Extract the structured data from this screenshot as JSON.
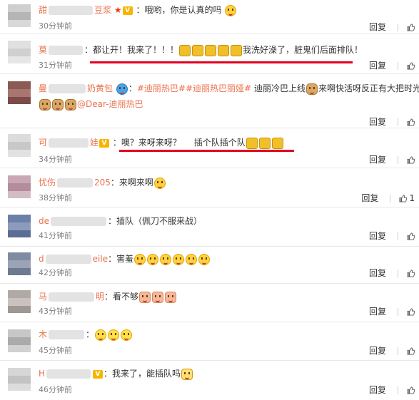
{
  "colors": {
    "username": "#eb7350",
    "annotation": "#e4001e",
    "text": "#333333",
    "time": "#808080"
  },
  "actions": {
    "reply": "回复"
  },
  "comments": [
    {
      "name_prefix": "甜",
      "name_suffix": "豆浆",
      "text": "：哦哟，你是认真的吗",
      "time": "30分钟前",
      "likes": ""
    },
    {
      "name_prefix": "莫",
      "name_suffix": "",
      "text_before": "：都让开！我来了！！！",
      "text_after": "我洗好澡了，脏鬼们后面排队！",
      "time": "31分钟前",
      "likes": ""
    },
    {
      "name_prefix": "曼",
      "name_suffix": "奶黄包",
      "topic1": "#迪丽热巴#",
      "topic2": "#迪丽热巴丽娅#",
      "text": " 迪丽冷巴上线",
      "text_after": "来啊快活呀反正有大把时光",
      "mention": "@Dear-迪丽热巴",
      "time": "",
      "likes": ""
    },
    {
      "name_prefix": "可",
      "name_suffix": "娃",
      "text": "：噢？来呀来呀？",
      "text_after": "插个队插个队",
      "time": "34分钟前",
      "likes": ""
    },
    {
      "name_prefix": "忧伤",
      "name_suffix": "205",
      "text": "：来啊来啊",
      "time": "38分钟前",
      "likes": "1"
    },
    {
      "name_prefix": "de",
      "name_suffix": "",
      "text": "：插队（佩刀不服来战）",
      "time": "41分钟前",
      "likes": ""
    },
    {
      "name_prefix": "d",
      "name_suffix": "eile",
      "text": "：害羞",
      "time": "42分钟前",
      "likes": ""
    },
    {
      "name_prefix": "马",
      "name_suffix": "明",
      "text": "：看不够",
      "time": "43分钟前",
      "likes": ""
    },
    {
      "name_prefix": "木",
      "name_suffix": "",
      "text": "：",
      "time": "45分钟前",
      "likes": ""
    },
    {
      "name_prefix": "H",
      "name_suffix": "",
      "text": "：我来了，能插队吗",
      "time": "46分钟前",
      "likes": ""
    }
  ]
}
